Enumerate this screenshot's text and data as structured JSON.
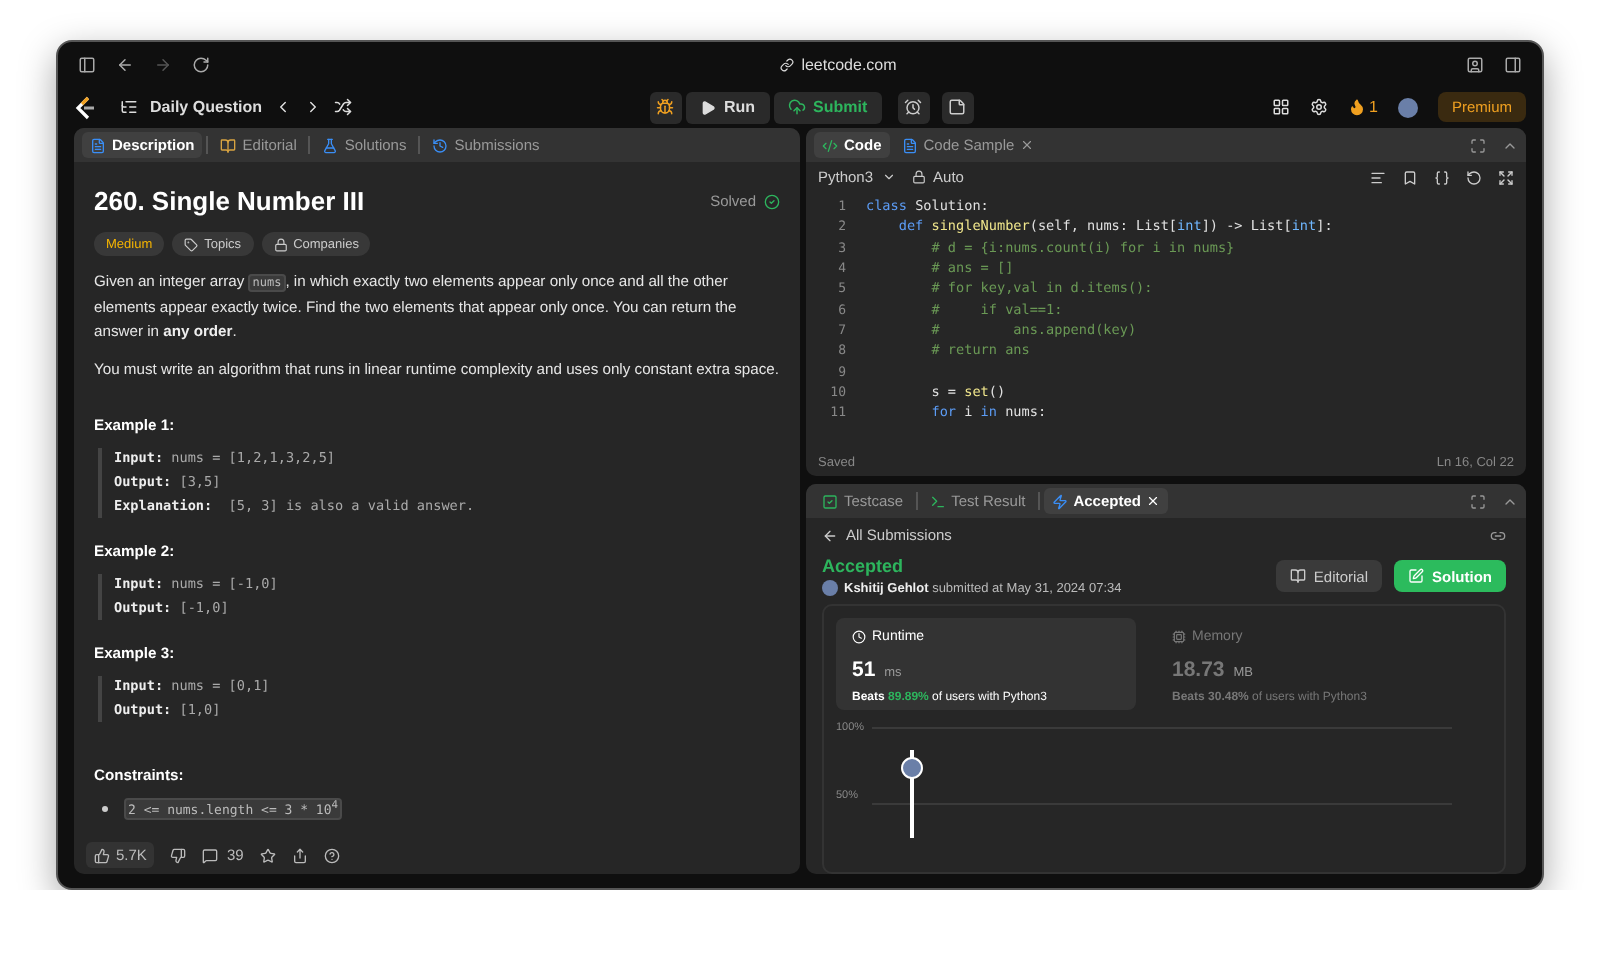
{
  "browser": {
    "url": "leetcode.com"
  },
  "toolbar": {
    "title": "Daily Question",
    "run": "Run",
    "submit": "Submit",
    "streak": "1",
    "premium": "Premium"
  },
  "left_tabs": [
    {
      "label": "Description",
      "selected": true,
      "kind": "description"
    },
    {
      "label": "Editorial",
      "selected": false,
      "kind": "editorial"
    },
    {
      "label": "Solutions",
      "selected": false,
      "kind": "solutions"
    },
    {
      "label": "Submissions",
      "selected": false,
      "kind": "submissions"
    }
  ],
  "problem": {
    "title": "260. Single Number III",
    "status": "Solved",
    "difficulty": "Medium",
    "tags": [
      {
        "label": "Topics",
        "kind": "tag"
      },
      {
        "label": "Companies",
        "kind": "lock"
      }
    ],
    "paragraphs": [
      [
        {
          "text": "Given an integer array ",
          "kind": "text"
        },
        {
          "text": "nums",
          "kind": "code"
        },
        {
          "text": ", in which exactly two elements appear only once and all the other elements appear exactly twice. Find the two elements that appear only once. You can return the answer in ",
          "kind": "text"
        },
        {
          "text": "any order",
          "kind": "bold"
        },
        {
          "text": ".",
          "kind": "text"
        }
      ],
      [
        {
          "text": "You must write an algorithm that runs in linear runtime complexity and uses only constant extra space.",
          "kind": "text"
        }
      ]
    ],
    "examples": [
      {
        "title": "Example 1:",
        "lines": [
          {
            "label": "Input:",
            "value": "nums = [1,2,1,3,2,5]"
          },
          {
            "label": "Output:",
            "value": "[3,5]"
          },
          {
            "label": "Explanation:",
            "value": " [5, 3] is also a valid answer."
          }
        ]
      },
      {
        "title": "Example 2:",
        "lines": [
          {
            "label": "Input:",
            "value": "nums = [-1,0]"
          },
          {
            "label": "Output:",
            "value": "[-1,0]"
          }
        ]
      },
      {
        "title": "Example 3:",
        "lines": [
          {
            "label": "Input:",
            "value": "nums = [0,1]"
          },
          {
            "label": "Output:",
            "value": "[1,0]"
          }
        ]
      }
    ],
    "constraints_title": "Constraints:",
    "constraints": [
      "2 <= nums.length <= 3 * 10$^{4}$"
    ],
    "likes": "5.7K",
    "comments": "39"
  },
  "code_tabs": [
    {
      "label": "Code",
      "selected": true,
      "closable": false
    },
    {
      "label": "Code Sample",
      "selected": false,
      "closable": true
    }
  ],
  "editor": {
    "language": "Python3",
    "mode": "Auto",
    "status": "Saved",
    "cursor": "Ln 16, Col 22",
    "lines": [
      {
        "n": "1",
        "parts": [
          {
            "text": "class ",
            "kind": "keyword"
          },
          {
            "text": "Solution:",
            "kind": "plain"
          }
        ]
      },
      {
        "n": "2",
        "parts": [
          {
            "text": "    def ",
            "kind": "keyword"
          },
          {
            "text": "singleNumber",
            "kind": "func"
          },
          {
            "text": "(self, nums: List[",
            "kind": "plain"
          },
          {
            "text": "int",
            "kind": "type"
          },
          {
            "text": "]) -> List[",
            "kind": "plain"
          },
          {
            "text": "int",
            "kind": "type"
          },
          {
            "text": "]:",
            "kind": "plain"
          }
        ]
      },
      {
        "n": "3",
        "parts": [
          {
            "text": "        # d = {i:nums.count(i) for i in nums}",
            "kind": "comment"
          }
        ]
      },
      {
        "n": "4",
        "parts": [
          {
            "text": "        # ans = []",
            "kind": "comment"
          }
        ]
      },
      {
        "n": "5",
        "parts": [
          {
            "text": "        # for key,val in d.items():",
            "kind": "comment"
          }
        ]
      },
      {
        "n": "6",
        "parts": [
          {
            "text": "        #     if val==1:",
            "kind": "comment"
          }
        ]
      },
      {
        "n": "7",
        "parts": [
          {
            "text": "        #         ans.append(key)",
            "kind": "comment"
          }
        ]
      },
      {
        "n": "8",
        "parts": [
          {
            "text": "        # return ans",
            "kind": "comment"
          }
        ]
      },
      {
        "n": "9"
      },
      {
        "n": "10",
        "parts": [
          {
            "text": "        s = ",
            "kind": "plain"
          },
          {
            "text": "set",
            "kind": "func"
          },
          {
            "text": "()",
            "kind": "plain"
          }
        ]
      },
      {
        "n": "11",
        "parts": [
          {
            "text": "        for ",
            "kind": "keyword"
          },
          {
            "text": "i ",
            "kind": "plain"
          },
          {
            "text": "in ",
            "kind": "keyword"
          },
          {
            "text": "nums:",
            "kind": "plain"
          }
        ]
      }
    ]
  },
  "result_tabs": [
    {
      "label": "Testcase",
      "selected": false,
      "kind": "testcase",
      "closable": false
    },
    {
      "label": "Test Result",
      "selected": false,
      "kind": "terminal",
      "closable": false
    },
    {
      "label": "Accepted",
      "selected": true,
      "kind": "accepted",
      "closable": true
    }
  ],
  "submission": {
    "back": "All Submissions",
    "verdict": "Accepted",
    "user": "Kshitij Gehlot",
    "submitted": "submitted at May 31, 2024 07:34",
    "editorial": "Editorial",
    "solution": "Solution",
    "stats": [
      {
        "title": "Runtime",
        "value": "51",
        "unit": "ms",
        "beats": "Beats",
        "percent": "89.89%",
        "suffix": "of users with Python3",
        "selected": true,
        "kind": "clock"
      },
      {
        "title": "Memory",
        "value": "18.73",
        "unit": "MB",
        "beats": "Beats",
        "percent": "30.48%",
        "suffix": "of users with Python3",
        "selected": false,
        "kind": "chip"
      }
    ],
    "axis_labels": [
      "100%",
      "50%"
    ]
  }
}
